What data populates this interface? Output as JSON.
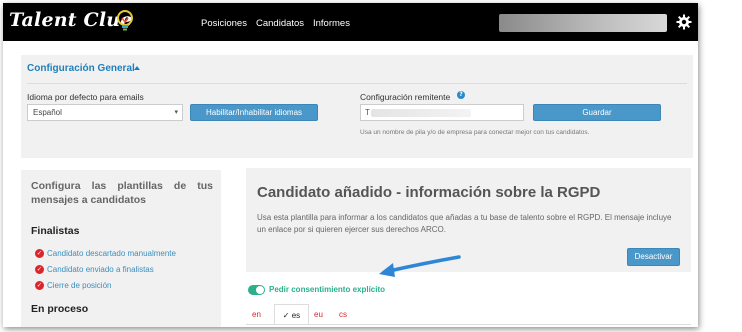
{
  "header": {
    "logo_text": "Talent Clue",
    "nav": [
      "Posiciones",
      "Candidatos",
      "Informes"
    ],
    "settings_icon": "gear-icon"
  },
  "config": {
    "title": "Configuración General",
    "language_label": "Idioma por defecto para emails",
    "language_value": "Español",
    "toggle_languages_button": "Habilitar/Inhabilitar idiomas",
    "sender_label": "Configuración remitente",
    "sender_value": "T",
    "save_button": "Guardar",
    "sender_hint": "Usa un nombre de pila y/o de empresa para conectar mejor con tus candidatos."
  },
  "sidebar": {
    "title": "Configura las plantillas de tus mensajes a candidatos",
    "sections": [
      {
        "heading": "Finalistas",
        "items": [
          "Candidato descartado manualmente",
          "Candidato enviado a finalistas",
          "Cierre de posición"
        ]
      },
      {
        "heading": "En proceso",
        "items": []
      }
    ]
  },
  "template": {
    "title": "Candidato añadido - información sobre la RGPD",
    "description": "Usa esta plantilla para informar a los candidatos que añadas a tu base de talento sobre el RGPD. El mensaje incluye un enlace por si quieren ejercer sus derechos ARCO.",
    "deactivate_button": "Desactivar",
    "consent_toggle_label": "Pedir consentimiento explícito",
    "consent_enabled": true,
    "languages": [
      "en",
      "es",
      "eu",
      "cs"
    ],
    "active_language": "es",
    "active_check": "✓"
  },
  "colors": {
    "accent": "#1f7fbd",
    "button": "#4a97c9",
    "toggle": "#2bb08a",
    "alert_red": "#d9262a",
    "arrow": "#2f86d6"
  }
}
